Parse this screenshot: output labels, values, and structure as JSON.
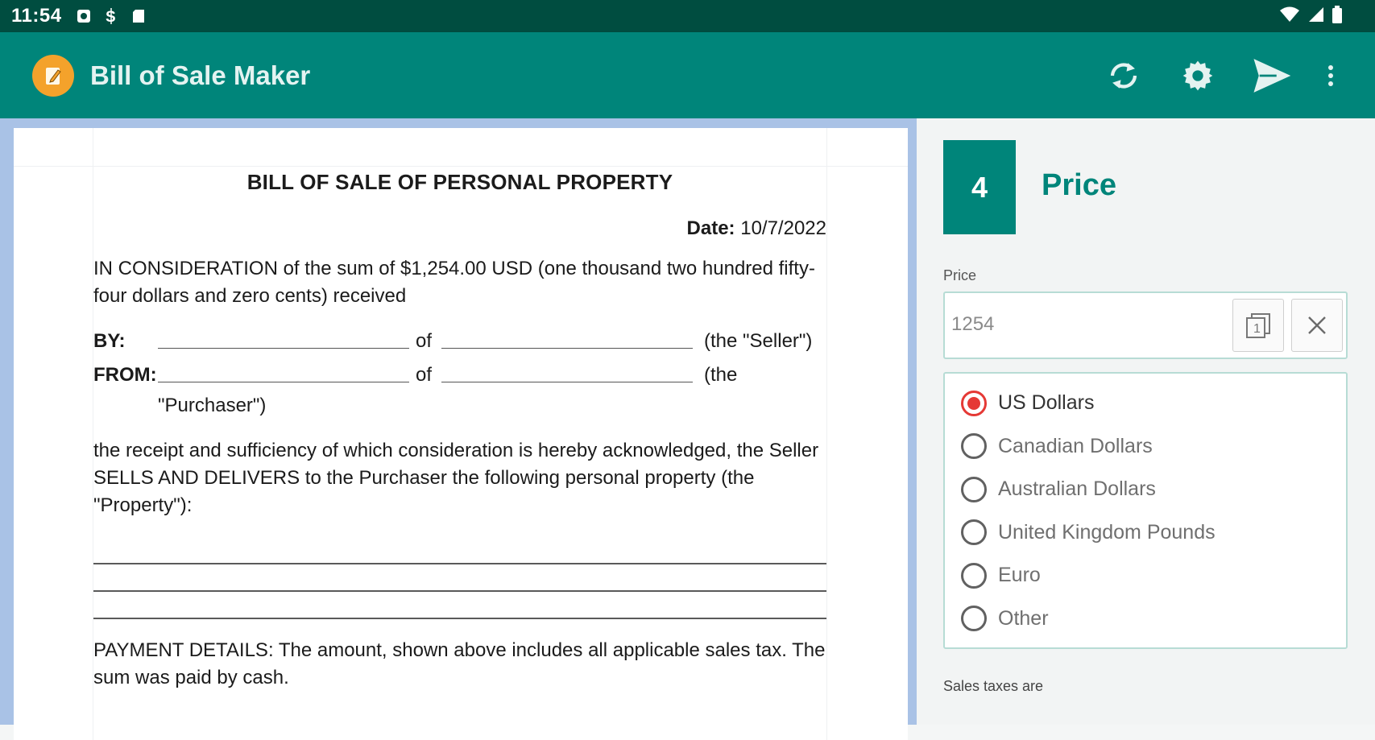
{
  "status_bar": {
    "time": "11:54",
    "icons_left": [
      "notification-icon",
      "s-app-icon",
      "sd-card-icon"
    ],
    "icons_right": [
      "wifi-icon",
      "signal-icon",
      "battery-icon"
    ]
  },
  "app_bar": {
    "title": "Bill of Sale Maker",
    "actions": [
      "refresh-icon",
      "settings-icon",
      "send-icon",
      "more-vert-icon"
    ]
  },
  "document": {
    "title": "BILL OF SALE OF PERSONAL PROPERTY",
    "date_label": "Date:",
    "date_value": "10/7/2022",
    "consideration": "IN CONSIDERATION of the sum of $1,254.00 USD (one thousand two hundred fifty-four dollars and zero cents) received",
    "by_label": "BY:",
    "from_label": "FROM:",
    "of_text": "of",
    "seller_suffix": "(the \"Seller\")",
    "purchaser_suffix": "(the",
    "purchaser_cont": "\"Purchaser\")",
    "receipt": "the receipt and sufficiency of which consideration is hereby acknowledged, the Seller SELLS AND DELIVERS to the Purchaser the following personal property (the \"Property\"):",
    "payment": "PAYMENT DETAILS: The amount, shown above includes all applicable sales tax. The sum was paid by cash."
  },
  "panel": {
    "step_number": "4",
    "step_title": "Price",
    "price_label": "Price",
    "price_value": "1254",
    "currencies": [
      {
        "label": "US Dollars",
        "selected": true
      },
      {
        "label": "Canadian Dollars",
        "selected": false
      },
      {
        "label": "Australian Dollars",
        "selected": false
      },
      {
        "label": "United Kingdom Pounds",
        "selected": false
      },
      {
        "label": "Euro",
        "selected": false
      },
      {
        "label": "Other",
        "selected": false
      }
    ],
    "sales_taxes_label": "Sales taxes are"
  },
  "colors": {
    "status_bar": "#004d40",
    "app_bar": "#00857a",
    "accent": "#00857a",
    "radio_selected": "#e53935",
    "logo": "#f4a22b"
  }
}
